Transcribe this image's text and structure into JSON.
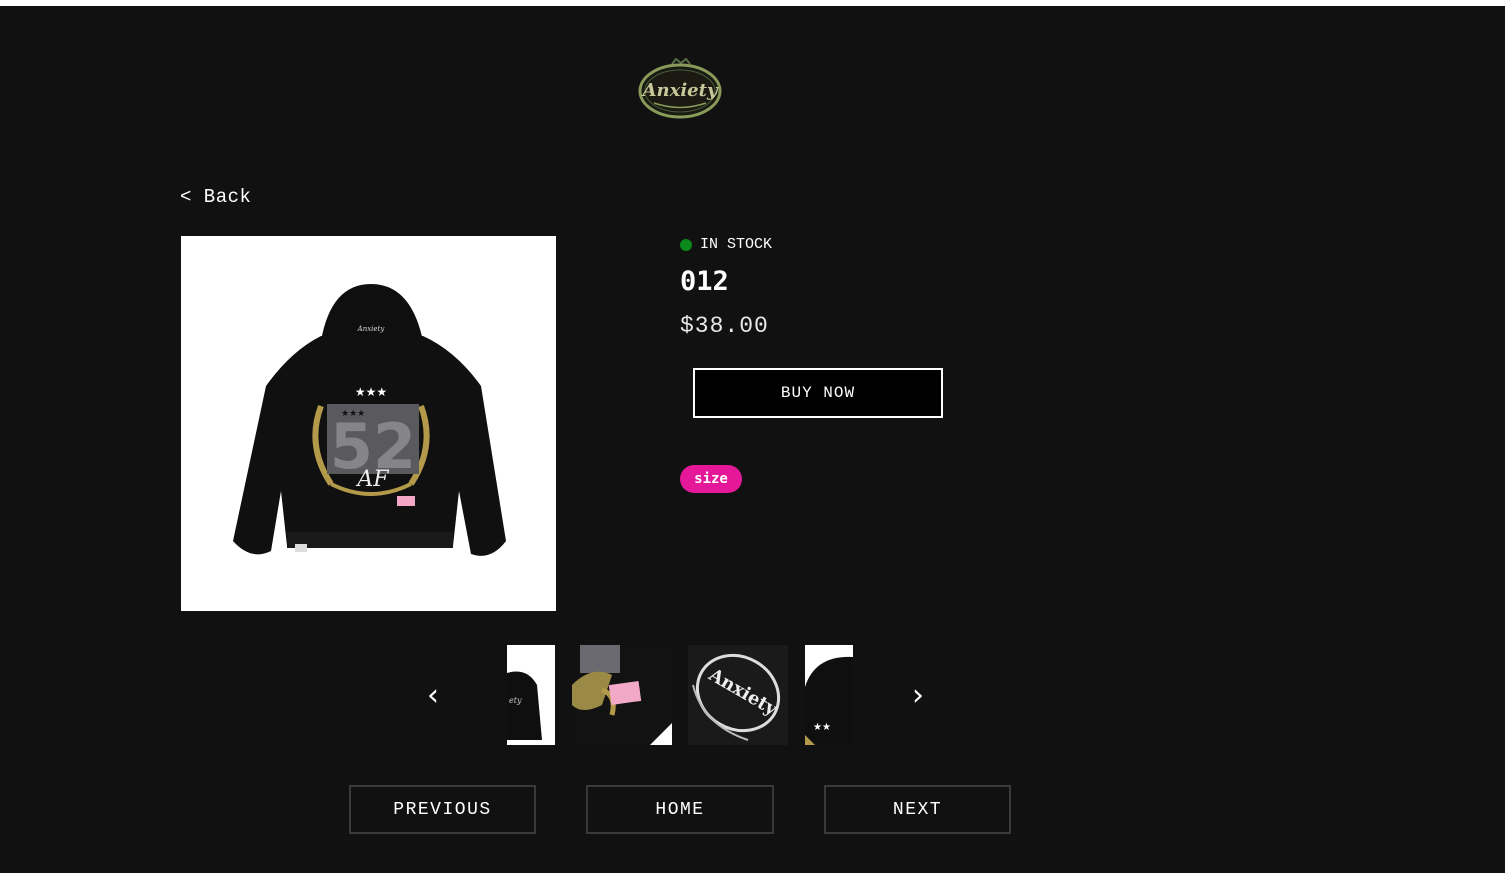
{
  "logo": {
    "icon": "anxiety-oval-logo",
    "text": "Anxiety"
  },
  "back_label": "< Back",
  "product": {
    "stock_status": "IN STOCK",
    "stock_color": "#0a8a1a",
    "title": "012",
    "price": "$38.00",
    "buy_label": "BUY NOW",
    "size_label": "size",
    "size_color": "#e6189a"
  },
  "carousel": {
    "prev_icon": "‹",
    "next_icon": "›"
  },
  "nav": {
    "previous": "PREVIOUS",
    "home": "HOME",
    "next": "NEXT"
  }
}
